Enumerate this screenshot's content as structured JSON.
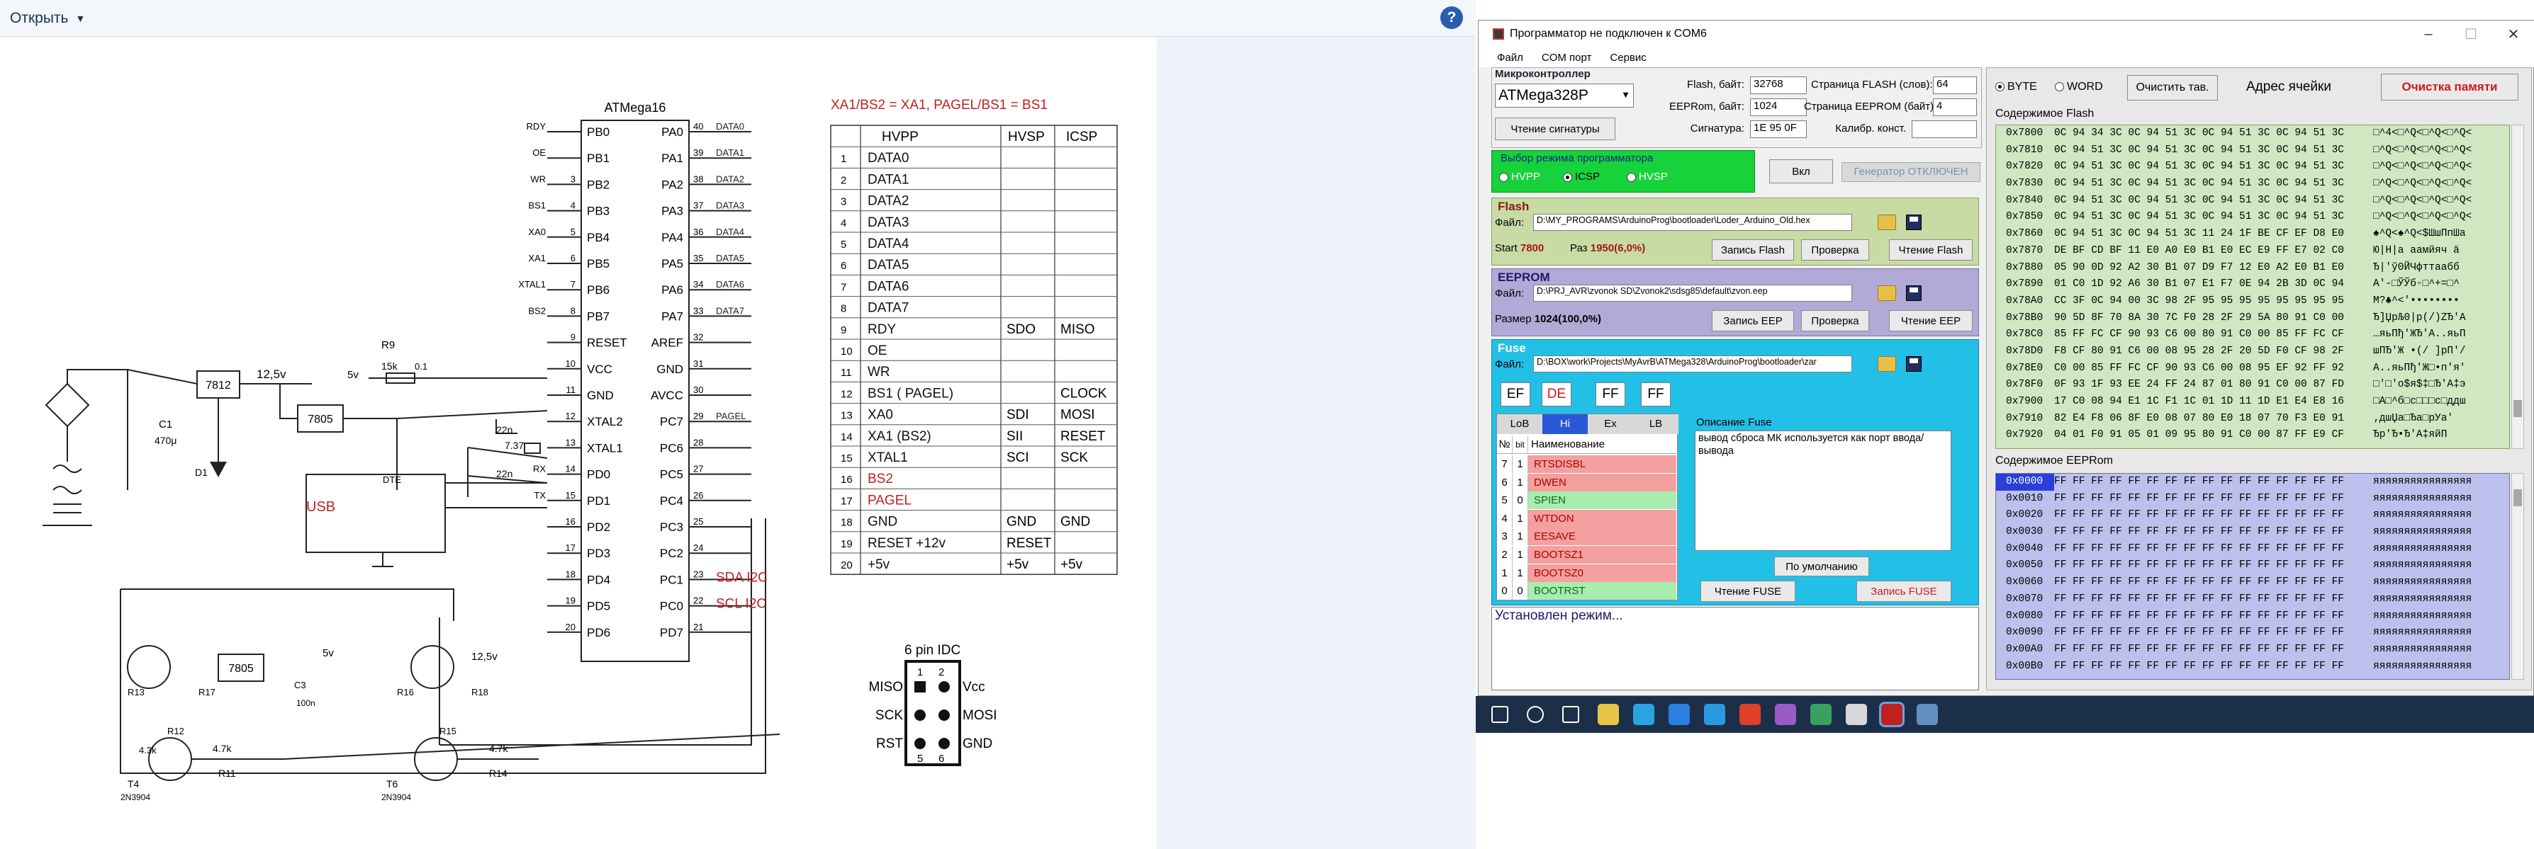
{
  "viewer": {
    "open_label": "Открыть",
    "help_label": "?"
  },
  "schematic": {
    "chip_label": "ATMega16",
    "mapping_note": "XA1/BS2 = XA1, PAGEL/BS1 = BS1",
    "left_pins": [
      {
        "num": "",
        "name": "PB0",
        "sig": "RDY"
      },
      {
        "num": "",
        "name": "PB1",
        "sig": "OE"
      },
      {
        "num": "3",
        "name": "PB2",
        "sig": "WR"
      },
      {
        "num": "4",
        "name": "PB3",
        "sig": "BS1"
      },
      {
        "num": "5",
        "name": "PB4",
        "sig": "XA0"
      },
      {
        "num": "6",
        "name": "PB5",
        "sig": "XA1"
      },
      {
        "num": "7",
        "name": "PB6",
        "sig": "XTAL1"
      },
      {
        "num": "8",
        "name": "PB7",
        "sig": "BS2"
      },
      {
        "num": "9",
        "name": "RESET",
        "sig": ""
      },
      {
        "num": "10",
        "name": "VCC",
        "sig": ""
      },
      {
        "num": "11",
        "name": "GND",
        "sig": ""
      },
      {
        "num": "12",
        "name": "XTAL2",
        "sig": ""
      },
      {
        "num": "13",
        "name": "XTAL1",
        "sig": ""
      },
      {
        "num": "14",
        "name": "PD0",
        "sig": "RX"
      },
      {
        "num": "15",
        "name": "PD1",
        "sig": "TX"
      },
      {
        "num": "16",
        "name": "PD2",
        "sig": ""
      },
      {
        "num": "17",
        "name": "PD3",
        "sig": ""
      },
      {
        "num": "18",
        "name": "PD4",
        "sig": ""
      },
      {
        "num": "19",
        "name": "PD5",
        "sig": ""
      },
      {
        "num": "20",
        "name": "PD6",
        "sig": ""
      }
    ],
    "right_pins": [
      {
        "num": "40",
        "name": "PA0",
        "sig": "DATA0"
      },
      {
        "num": "39",
        "name": "PA1",
        "sig": "DATA1"
      },
      {
        "num": "38",
        "name": "PA2",
        "sig": "DATA2"
      },
      {
        "num": "37",
        "name": "PA3",
        "sig": "DATA3"
      },
      {
        "num": "36",
        "name": "PA4",
        "sig": "DATA4"
      },
      {
        "num": "35",
        "name": "PA5",
        "sig": "DATA5"
      },
      {
        "num": "34",
        "name": "PA6",
        "sig": "DATA6"
      },
      {
        "num": "33",
        "name": "PA7",
        "sig": "DATA7"
      },
      {
        "num": "32",
        "name": "AREF",
        "sig": ""
      },
      {
        "num": "31",
        "name": "GND",
        "sig": ""
      },
      {
        "num": "30",
        "name": "AVCC",
        "sig": ""
      },
      {
        "num": "29",
        "name": "PC7",
        "sig": "PAGEL"
      },
      {
        "num": "28",
        "name": "PC6",
        "sig": ""
      },
      {
        "num": "27",
        "name": "PC5",
        "sig": ""
      },
      {
        "num": "26",
        "name": "PC4",
        "sig": ""
      },
      {
        "num": "25",
        "name": "PC3",
        "sig": ""
      },
      {
        "num": "24",
        "name": "PC2",
        "sig": ""
      },
      {
        "num": "23",
        "name": "PC1",
        "sig": "SDA I2C"
      },
      {
        "num": "22",
        "name": "PC0",
        "sig": "SCL I2C"
      },
      {
        "num": "21",
        "name": "PD7",
        "sig": ""
      }
    ],
    "parts": {
      "reg1": "7812",
      "reg2": "7805",
      "reg3": "7805",
      "usb": "USB",
      "dte": "DTE",
      "c1": "C1",
      "c1v": "470μ",
      "d1": "D1",
      "v125": "12,5v",
      "v5": "5v",
      "v5b": "5v",
      "v125b": "12,5v",
      "r9": "R9",
      "r9v": "15k",
      "c0_1": "0.1",
      "c22a": "22n",
      "c22b": "22n",
      "xtal": "7.37",
      "r11": "R11",
      "r11v": "4.7k",
      "r14": "R14",
      "r14v": "4.7k",
      "r12": "R12",
      "r12v": "4.3k",
      "r13": "R13",
      "r16": "R16",
      "r17": "R17",
      "r15": "R15",
      "r18": "R18",
      "t4": "T4",
      "t6": "T6",
      "tnpn": "2N3904",
      "c3": "C3",
      "c3v": "100n"
    },
    "table": {
      "headers": [
        "HVPP",
        "HVSP",
        "ICSP"
      ],
      "rows": [
        {
          "n": "1",
          "hvpp": "DATA0",
          "hvsp": "",
          "icsp": "",
          "red": false
        },
        {
          "n": "2",
          "hvpp": "DATA1",
          "hvsp": "",
          "icsp": "",
          "red": false
        },
        {
          "n": "3",
          "hvpp": "DATA2",
          "hvsp": "",
          "icsp": "",
          "red": false
        },
        {
          "n": "4",
          "hvpp": "DATA3",
          "hvsp": "",
          "icsp": "",
          "red": false
        },
        {
          "n": "5",
          "hvpp": "DATA4",
          "hvsp": "",
          "icsp": "",
          "red": false
        },
        {
          "n": "6",
          "hvpp": "DATA5",
          "hvsp": "",
          "icsp": "",
          "red": false
        },
        {
          "n": "7",
          "hvpp": "DATA6",
          "hvsp": "",
          "icsp": "",
          "red": false
        },
        {
          "n": "8",
          "hvpp": "DATA7",
          "hvsp": "",
          "icsp": "",
          "red": false
        },
        {
          "n": "9",
          "hvpp": "RDY",
          "hvsp": "SDO",
          "icsp": "MISO",
          "red": false
        },
        {
          "n": "10",
          "hvpp": "OE",
          "hvsp": "",
          "icsp": "",
          "red": false
        },
        {
          "n": "11",
          "hvpp": "WR",
          "hvsp": "",
          "icsp": "",
          "red": false
        },
        {
          "n": "12",
          "hvpp": "BS1 ( PAGEL)",
          "hvsp": "",
          "icsp": "CLOCK",
          "red": false
        },
        {
          "n": "13",
          "hvpp": "XA0",
          "hvsp": "SDI",
          "icsp": "MOSI",
          "red": false
        },
        {
          "n": "14",
          "hvpp": "XA1 (BS2)",
          "hvsp": "SII",
          "icsp": "RESET",
          "red": false
        },
        {
          "n": "15",
          "hvpp": "XTAL1",
          "hvsp": "SCI",
          "icsp": "SCK",
          "red": false
        },
        {
          "n": "16",
          "hvpp": "BS2",
          "hvsp": "",
          "icsp": "",
          "red": true
        },
        {
          "n": "17",
          "hvpp": "PAGEL",
          "hvsp": "",
          "icsp": "",
          "red": true
        },
        {
          "n": "18",
          "hvpp": "GND",
          "hvsp": "GND",
          "icsp": "GND",
          "red": false
        },
        {
          "n": "19",
          "hvpp": "RESET +12v",
          "hvsp": "RESET",
          "icsp": "",
          "red": false
        },
        {
          "n": "20",
          "hvpp": "+5v",
          "hvsp": "+5v",
          "icsp": "+5v",
          "red": false
        }
      ]
    },
    "idc": {
      "title": "6 pin IDC",
      "miso": "MISO",
      "vcc": "Vcc",
      "sck": "SCK",
      "mosi": "MOSI",
      "rst": "RST",
      "gnd": "GND",
      "p1": "1",
      "p2": "2",
      "p5": "5",
      "p6": "6"
    }
  },
  "programmer": {
    "title": "Программатор не подключен к COM6",
    "menu": [
      "Файл",
      "COM порт",
      "Сервис"
    ],
    "mcu_section": "Микроконтроллер",
    "mcu_value": "ATMega328P",
    "read_sig_button": "Чтение сигнатуры",
    "flash_bytes_label": "Flash, байт:",
    "flash_bytes_value": "32768",
    "eeprom_bytes_label": "EEPRom, байт:",
    "eeprom_bytes_value": "1024",
    "signature_label": "Сигнатура:",
    "signature_value": "1E 95 0F",
    "flash_page_label": "Страница FLASH (слов):",
    "flash_page_value": "64",
    "eeprom_page_label": "Страница EEPROM (байт):",
    "eeprom_page_value": "4",
    "calib_label": "Калибр. конст.",
    "calib_value": "",
    "mode_section": "Выбор режима программатора",
    "modes": [
      {
        "label": "HVPP",
        "on": false
      },
      {
        "label": "ICSP",
        "on": true
      },
      {
        "label": "HVSP",
        "on": false
      }
    ],
    "on_button": "Вкл",
    "generator_label": "Генератор ОТКЛЮЧЕН",
    "flash_section": "Flash",
    "file_label": "Файл:",
    "flash_file": "D:\\MY_PROGRAMS\\ArduinoProg\\bootloader\\Loder_Arduino_Old.hex",
    "flash_start_label": "Start",
    "flash_start_value": "7800",
    "flash_size_label": "Раз",
    "flash_size_value": "1950(6,0%)",
    "flash_write_button": "Запись Flash",
    "flash_verify_button": "Проверка",
    "flash_read_button": "Чтение Flash",
    "eeprom_section": "EEPROM",
    "eeprom_file": "D:\\PRJ_AVR\\zvonok SD\\Zvonok2\\sdsg85\\default\\zvon.eep",
    "eeprom_size_label": "Размер",
    "eeprom_size_value": "1024(100,0%)",
    "eeprom_write_button": "Запись EEP",
    "eeprom_verify_button": "Проверка",
    "eeprom_read_button": "Чтение EEP",
    "fuse_section": "Fuse",
    "fuse_file": "D:\\BOX\\work\\Projects\\MyAvrB\\ATMega328\\ArduinoProg\\bootloader\\zar",
    "fuse_values": [
      "EF",
      "DE",
      "FF",
      "FF"
    ],
    "fuse_tabs": [
      "LoB",
      "Hi",
      "Ex",
      "LB"
    ],
    "fuse_col_n": "№",
    "fuse_col_bit": "bit",
    "fuse_col_name": "Наименование",
    "fuse_rows": [
      {
        "n": "7",
        "bit": "1",
        "name": "RTSDISBL",
        "ok": false
      },
      {
        "n": "6",
        "bit": "1",
        "name": "DWEN",
        "ok": false
      },
      {
        "n": "5",
        "bit": "0",
        "name": "SPIEN",
        "ok": true
      },
      {
        "n": "4",
        "bit": "1",
        "name": "WTDON",
        "ok": false
      },
      {
        "n": "3",
        "bit": "1",
        "name": "EESAVE",
        "ok": false
      },
      {
        "n": "2",
        "bit": "1",
        "name": "BOOTSZ1",
        "ok": false
      },
      {
        "n": "1",
        "bit": "1",
        "name": "BOOTSZ0",
        "ok": false
      },
      {
        "n": "0",
        "bit": "0",
        "name": "BOOTRST",
        "ok": true
      }
    ],
    "fuse_desc_label": "Описание Fuse",
    "fuse_desc_text": "вывод сброса МК используется как порт ввода/вывода",
    "fuse_default_button": "По умолчанию",
    "fuse_read_button": "Чтение FUSE",
    "fuse_write_button": "Запись FUSE",
    "status_text": "Установлен режим...",
    "byte_label": "BYTE",
    "word_label": "WORD",
    "clear_button": "Очистить тав.",
    "cell_addr_label": "Адрес ячейки",
    "clear_mem_button": "Очистка памяти",
    "flash_content_label": "Содержимое Flash",
    "eeprom_content_label": "Содержимое EEPRom",
    "flash_rows": [
      {
        "a": "0x7800",
        "b": "0C 94 34 3C 0C 94 51 3C 0C 94 51 3C 0C 94 51 3C",
        "c": "□^4<□^Q<□^Q<□^Q<"
      },
      {
        "a": "0x7810",
        "b": "0C 94 51 3C 0C 94 51 3C 0C 94 51 3C 0C 94 51 3C",
        "c": "□^Q<□^Q<□^Q<□^Q<"
      },
      {
        "a": "0x7820",
        "b": "0C 94 51 3C 0C 94 51 3C 0C 94 51 3C 0C 94 51 3C",
        "c": "□^Q<□^Q<□^Q<□^Q<"
      },
      {
        "a": "0x7830",
        "b": "0C 94 51 3C 0C 94 51 3C 0C 94 51 3C 0C 94 51 3C",
        "c": "□^Q<□^Q<□^Q<□^Q<"
      },
      {
        "a": "0x7840",
        "b": "0C 94 51 3C 0C 94 51 3C 0C 94 51 3C 0C 94 51 3C",
        "c": "□^Q<□^Q<□^Q<□^Q<"
      },
      {
        "a": "0x7850",
        "b": "0C 94 51 3C 0C 94 51 3C 0C 94 51 3C 0C 94 51 3C",
        "c": "□^Q<□^Q<□^Q<□^Q<"
      },
      {
        "a": "0x7860",
        "b": "0C 94 51 3C 0C 94 51 3C 11 24 1F BE CF EF D8 E0",
        "c": "♠^Q<♠^Q<$ШшПпШа"
      },
      {
        "a": "0x7870",
        "b": "DE BF CD BF 11 E0 A0 E0 B1 E0 EC E9 FF E7 02 C0",
        "c": "Ю|Н|а аамйяч ä"
      },
      {
        "a": "0x7880",
        "b": "05 90 0D 92 A2 30 B1 07 D9 F7 12 E0 A2 E0 B1 E0",
        "c": "Ђ|'ў0ЙЧфттаабб"
      },
      {
        "a": "0x7890",
        "b": "01 C0 1D 92 A6 30 B1 07 E1 F7 0E 94 2B 3D 0C 94",
        "c": "А'-□ЎЎб◦□^+=□^"
      },
      {
        "a": "0x78A0",
        "b": "CC 3F 0C 94 00 3C 98 2F 95 95 95 95 95 95 95 95",
        "c": "М?♣^<'••••••••"
      },
      {
        "a": "0x78B0",
        "b": "90 5D 8F 70 8A 30 7C F0 28 2F 29 5A 80 91 C0 00",
        "c": "Ђ]ЏрЉ0|р(/)ZЂ'А"
      },
      {
        "a": "0x78C0",
        "b": "85 FF FC CF 90 93 C6 00 80 91 C0 00 85 FF FC CF",
        "c": "…яьПђ'ЖЂ'А..яьП"
      },
      {
        "a": "0x78D0",
        "b": "F8 CF 80 91 C6 00 08 95 28 2F 20 5D F0 CF 98 2F",
        "c": "шПЂ'Ж •(/ ]рП'/"
      },
      {
        "a": "0x78E0",
        "b": "C0 00 85 FF FC CF 90 93 C6 00 08 95 EF 92 FF 92",
        "c": "А..яьПђ'Ж□•п'я'"
      },
      {
        "a": "0x78F0",
        "b": "0F 93 1F 93 EE 24 FF 24 87 01 80 91 C0 00 87 FD",
        "c": "□'□'о$я$‡□Ђ'А‡э"
      },
      {
        "a": "0x7900",
        "b": "17 C0 08 94 E1 1C F1 1C 01 1D 11 1D E1 E4 E8 16",
        "c": "□А□^б□с□□□с□ддш"
      },
      {
        "a": "0x7910",
        "b": "82 E4 F8 06 8F E0 08 07 80 E0 18 07 70 F3 E0 91",
        "c": "‚дшЏа□Ђа□рУа'"
      },
      {
        "a": "0x7920",
        "b": "04 01 F0 91 05 01 09 95 80 91 C0 00 87 FF E9 CF",
        "c": "Ђр'Ђ•Ђ'А‡яйП"
      }
    ],
    "eeprom_rows": [
      {
        "a": "0x0000",
        "b": "FF FF FF FF FF FF FF FF FF FF FF FF FF FF FF FF",
        "c": "яяяяяяяяяяяяяяяя"
      },
      {
        "a": "0x0010",
        "b": "FF FF FF FF FF FF FF FF FF FF FF FF FF FF FF FF",
        "c": "яяяяяяяяяяяяяяяя"
      },
      {
        "a": "0x0020",
        "b": "FF FF FF FF FF FF FF FF FF FF FF FF FF FF FF FF",
        "c": "яяяяяяяяяяяяяяяя"
      },
      {
        "a": "0x0030",
        "b": "FF FF FF FF FF FF FF FF FF FF FF FF FF FF FF FF",
        "c": "яяяяяяяяяяяяяяяя"
      },
      {
        "a": "0x0040",
        "b": "FF FF FF FF FF FF FF FF FF FF FF FF FF FF FF FF",
        "c": "яяяяяяяяяяяяяяяя"
      },
      {
        "a": "0x0050",
        "b": "FF FF FF FF FF FF FF FF FF FF FF FF FF FF FF FF",
        "c": "яяяяяяяяяяяяяяяя"
      },
      {
        "a": "0x0060",
        "b": "FF FF FF FF FF FF FF FF FF FF FF FF FF FF FF FF",
        "c": "яяяяяяяяяяяяяяяя"
      },
      {
        "a": "0x0070",
        "b": "FF FF FF FF FF FF FF FF FF FF FF FF FF FF FF FF",
        "c": "яяяяяяяяяяяяяяяя"
      },
      {
        "a": "0x0080",
        "b": "FF FF FF FF FF FF FF FF FF FF FF FF FF FF FF FF",
        "c": "яяяяяяяяяяяяяяяя"
      },
      {
        "a": "0x0090",
        "b": "FF FF FF FF FF FF FF FF FF FF FF FF FF FF FF FF",
        "c": "яяяяяяяяяяяяяяяя"
      },
      {
        "a": "0x00A0",
        "b": "FF FF FF FF FF FF FF FF FF FF FF FF FF FF FF FF",
        "c": "яяяяяяяяяяяяяяяя"
      },
      {
        "a": "0x00B0",
        "b": "FF FF FF FF FF FF FF FF FF FF FF FF FF FF FF FF",
        "c": "яяяяяяяяяяяяяяяя"
      }
    ]
  },
  "taskbar": {
    "icons": [
      "windows-start-icon",
      "search-icon",
      "task-view-icon",
      "file-explorer-icon",
      "telegram-icon",
      "onedrive-icon",
      "edge-icon",
      "chrome-icon",
      "app-icon-1",
      "app-icon-2",
      "app-icon-3",
      "programmer-app-icon",
      "window-app-icon"
    ]
  },
  "colors": {
    "mode_panel": "#17d23a",
    "flash_panel": "#c9dba4",
    "eeprom_panel": "#b3a9d6",
    "fuse_panel": "#22c0e6",
    "hex_flash_bg": "#cfe8c2",
    "hex_eeprom_bg": "#bcc0ec",
    "hex_sel": "#2a3fd8",
    "fuse_red": "#f2a0a0",
    "fuse_green": "#a8ecb0"
  }
}
